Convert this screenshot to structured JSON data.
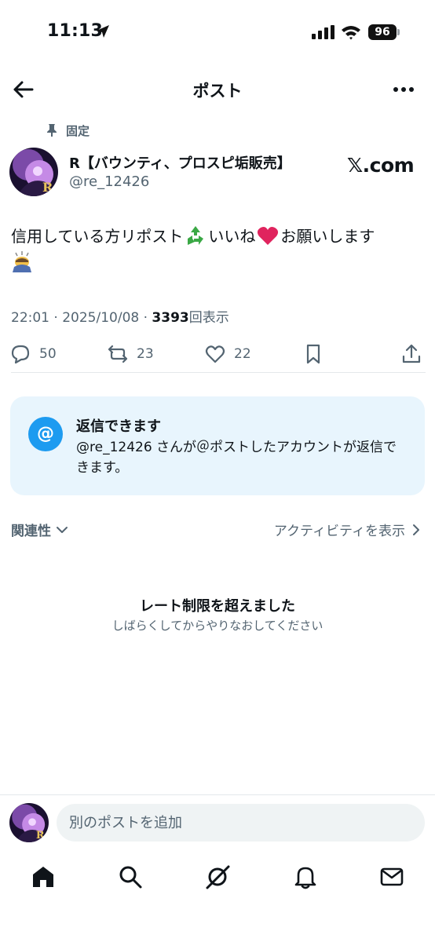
{
  "status_bar": {
    "time": "11:13",
    "battery": "96"
  },
  "header": {
    "title": "ポスト"
  },
  "post": {
    "pinned_label": "固定",
    "user_name": "R【バウンティ、プロスピ垢販売】",
    "user_handle": "@re_12426",
    "watermark": "𝕏.com",
    "text_part1": "信用している方リポスト",
    "text_part2": "いいね",
    "text_part3": "お願いします",
    "time": "22:01",
    "date": "2025/10/08",
    "views_count": "3393",
    "views_label": "回表示",
    "replies": "50",
    "reposts": "23",
    "likes": "22"
  },
  "reply_card": {
    "title": "返信できます",
    "description": "@re_12426 さんが＠ポストしたアカウントが返信できます。"
  },
  "sort": {
    "left_label": "関連性",
    "right_label": "アクティビティを表示"
  },
  "rate_limit": {
    "title": "レート制限を超えました",
    "subtitle": "しばらくしてからやりなおしてください"
  },
  "compose": {
    "placeholder": "別のポストを追加"
  },
  "tab_bar": {
    "icons": [
      "home-icon",
      "search-icon",
      "grok-icon",
      "notifications-icon",
      "messages-icon"
    ]
  },
  "colors": {
    "accent": "#1d9bf0",
    "secondary_text": "#536471",
    "reply_card_bg": "#e8f5fd",
    "heart": "#e0245e",
    "recycle": "#3aa845"
  }
}
